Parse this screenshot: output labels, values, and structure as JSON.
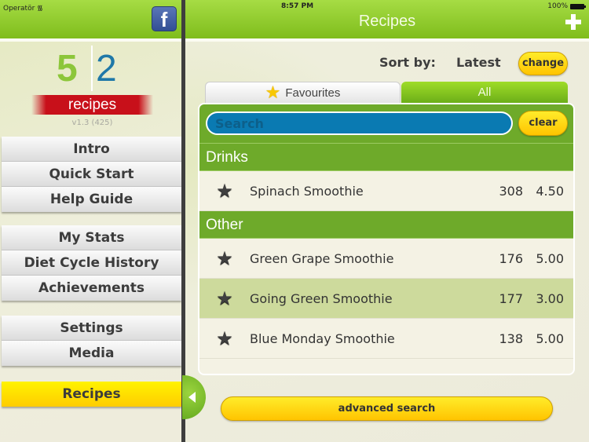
{
  "status_bar": {
    "carrier": "Operatör",
    "time": "8:57 PM",
    "battery": "100%"
  },
  "header": {
    "title": "Recipes",
    "add_icon": "plus-icon",
    "facebook_icon": "f"
  },
  "logo": {
    "number_left": "5",
    "number_right": "2",
    "label": "recipes",
    "version": "v1.3 (425)"
  },
  "sidebar": {
    "groups": [
      [
        "Intro",
        "Quick Start",
        "Help Guide"
      ],
      [
        "My Stats",
        "Diet Cycle History",
        "Achievements"
      ],
      [
        "Settings",
        "Media"
      ],
      [
        "Recipes"
      ]
    ],
    "active": "Recipes"
  },
  "sort": {
    "label": "Sort by:",
    "value": "Latest",
    "change_label": "change"
  },
  "tabs": {
    "favourites": "Favourites",
    "all": "All",
    "active": "All"
  },
  "search": {
    "placeholder": "Search",
    "value": "",
    "clear_label": "clear"
  },
  "sections": [
    {
      "title": "Drinks",
      "rows": [
        {
          "name": "Spinach Smoothie",
          "calories": "308",
          "rating": "4.50",
          "selected": false
        }
      ]
    },
    {
      "title": "Other",
      "rows": [
        {
          "name": "Green Grape Smoothie",
          "calories": "176",
          "rating": "5.00",
          "selected": false
        },
        {
          "name": "Going Green Smoothie",
          "calories": "177",
          "rating": "3.00",
          "selected": true
        },
        {
          "name": "Blue Monday Smoothie",
          "calories": "138",
          "rating": "5.00",
          "selected": false
        }
      ]
    }
  ],
  "advanced_search_label": "advanced search",
  "colors": {
    "brand_green": "#7fbd1c",
    "section_green": "#6eaa2a",
    "search_blue": "#0a7ab2",
    "button_yellow": "#ffd400",
    "logo_red": "#c8101a"
  }
}
